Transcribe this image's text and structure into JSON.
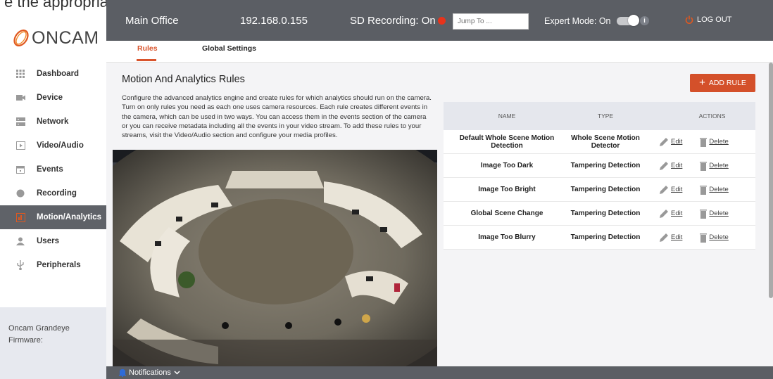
{
  "page": {
    "top_fragment": "e the appropriate permissions"
  },
  "logo": {
    "text": "ONCAM",
    "icon": "oncam-swirl-logo"
  },
  "sidebar": {
    "items": [
      {
        "label": "Dashboard",
        "icon": "grid-icon"
      },
      {
        "label": "Device",
        "icon": "camera-icon"
      },
      {
        "label": "Network",
        "icon": "network-icon"
      },
      {
        "label": "Video/Audio",
        "icon": "play-icon"
      },
      {
        "label": "Events",
        "icon": "calendar-icon"
      },
      {
        "label": "Recording",
        "icon": "record-icon"
      },
      {
        "label": "Motion/Analytics",
        "icon": "analytics-icon",
        "active": true
      },
      {
        "label": "Users",
        "icon": "user-icon"
      },
      {
        "label": "Peripherals",
        "icon": "usb-icon"
      }
    ],
    "device_name": "Oncam Grandeye",
    "firmware_label": "Firmware:"
  },
  "topbar": {
    "location": "Main Office",
    "ip": "192.168.0.155",
    "sd_recording": "SD Recording: On",
    "jump_placeholder": "Jump To ...",
    "expert_mode": "Expert Mode: On",
    "logout": "LOG OUT"
  },
  "tabs": [
    {
      "label": "Rules",
      "active": true
    },
    {
      "label": "Global Settings",
      "active": false
    }
  ],
  "main": {
    "title": "Motion And Analytics Rules",
    "description": "Configure the advanced analytics engine and create rules for which analytics should run on the camera. Turn on only rules you need as each one uses camera resources. Each rule creates different events in the camera, which can be used in two ways. You can access them in the events section of the camera or you can receive metadata including all the events in your video stream. To add these rules to your streams, visit the Video/Audio section and configure your media profiles.",
    "add_button": "ADD RULE"
  },
  "table": {
    "headers": [
      "NAME",
      "TYPE",
      "ACTIONS"
    ],
    "edit_label": "Edit",
    "delete_label": "Delete",
    "rows": [
      {
        "name": "Default Whole Scene Motion Detection",
        "type": "Whole Scene Motion Detector"
      },
      {
        "name": "Image Too Dark",
        "type": "Tampering Detection"
      },
      {
        "name": "Image Too Bright",
        "type": "Tampering Detection"
      },
      {
        "name": "Global Scene Change",
        "type": "Tampering Detection"
      },
      {
        "name": "Image Too Blurry",
        "type": "Tampering Detection"
      }
    ]
  },
  "footer": {
    "notifications": "Notifications"
  },
  "colors": {
    "accent": "#d4502a",
    "topbar": "#5b5e64",
    "sd_dot": "#e8331b"
  }
}
